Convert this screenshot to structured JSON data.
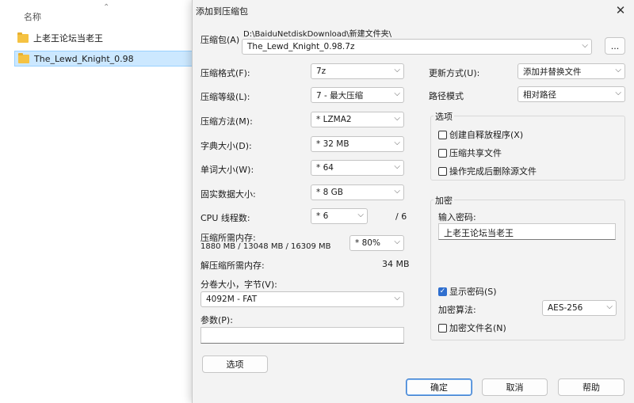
{
  "explorer": {
    "column_header": "名称",
    "files": [
      {
        "name": "上老王论坛当老王",
        "icon": "folder-icon"
      },
      {
        "name": "The_Lewd_Knight_0.98",
        "icon": "folder-icon"
      }
    ]
  },
  "dialog": {
    "title": "添加到压缩包",
    "archive": {
      "label": "压缩包(A)",
      "path": "D:\\BaiduNetdiskDownload\\新建文件夹\\",
      "filename": "The_Lewd_Knight_0.98.7z",
      "browse_label": "..."
    },
    "left": {
      "format": {
        "label": "压缩格式(F):",
        "value": "7z"
      },
      "level": {
        "label": "压缩等级(L):",
        "value": "7 - 最大压缩"
      },
      "method": {
        "label": "压缩方法(M):",
        "value": "* LZMA2"
      },
      "dict": {
        "label": "字典大小(D):",
        "value": "* 32 MB"
      },
      "word": {
        "label": "单词大小(W):",
        "value": "* 64"
      },
      "solid": {
        "label": "固实数据大小:",
        "value": "* 8 GB"
      },
      "threads": {
        "label": "CPU 线程数:",
        "value": "* 6",
        "total": "/ 6"
      },
      "mem_compress": {
        "label": "压缩所需内存:",
        "detail": "1880 MB / 13048 MB / 16309 MB",
        "value": "* 80%"
      },
      "mem_decompress": {
        "label": "解压缩所需内存:",
        "value": "34 MB"
      },
      "volume": {
        "label": "分卷大小，字节(V):",
        "value": "4092M - FAT"
      },
      "params": {
        "label": "参数(P):",
        "value": ""
      },
      "options_button": "选项"
    },
    "right": {
      "update": {
        "label": "更新方式(U):",
        "value": "添加并替换文件"
      },
      "path_mode": {
        "label": "路径模式",
        "value": "相对路径"
      },
      "options_group": {
        "title": "选项",
        "sfx": {
          "label": "创建自释放程序(X)",
          "checked": false
        },
        "shared": {
          "label": "压缩共享文件",
          "checked": false
        },
        "delete": {
          "label": "操作完成后删除源文件",
          "checked": false
        }
      },
      "encryption": {
        "title": "加密",
        "password_label": "输入密码:",
        "password_value": "上老王论坛当老王",
        "show_password": {
          "label": "显示密码(S)",
          "checked": true
        },
        "method_label": "加密算法:",
        "method_value": "AES-256",
        "encrypt_names": {
          "label": "加密文件名(N)",
          "checked": false
        }
      }
    },
    "buttons": {
      "ok": "确定",
      "cancel": "取消",
      "help": "帮助"
    }
  },
  "colors": {
    "accent": "#2f6fcf",
    "selection": "#cce8ff",
    "folder": "#f5c242",
    "desktop_strip": "#b9647a"
  }
}
